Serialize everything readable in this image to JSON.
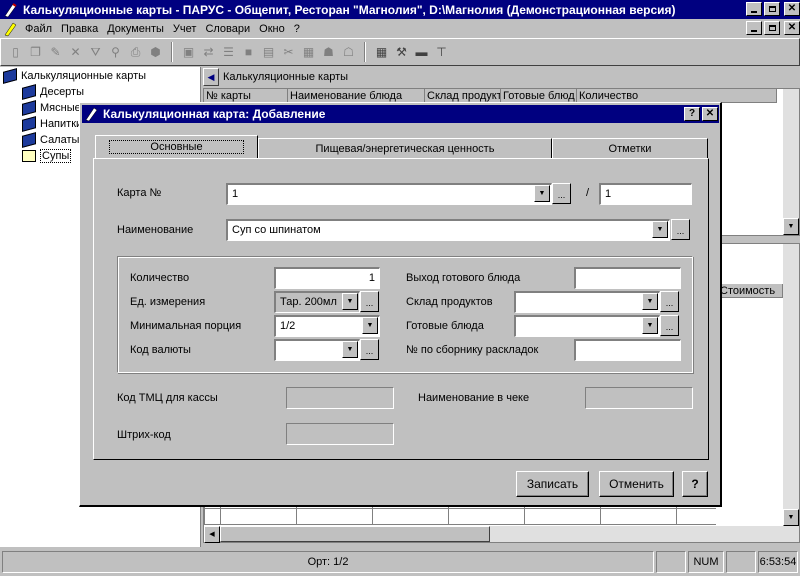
{
  "app": {
    "title": "Калькуляционные карты - ПАРУС - Общепит, Ресторан \"Магнолия\", D:\\Магнолия (Демонстрационная версия)"
  },
  "menu": {
    "items": [
      "Файл",
      "Правка",
      "Документы",
      "Учет",
      "Словари",
      "Окно",
      "?"
    ]
  },
  "tree": {
    "root": "Калькуляционные карты",
    "items": [
      "Десерты",
      "Мясные",
      "Напитки",
      "Салаты",
      "Супы"
    ]
  },
  "list_panel": {
    "title": "Калькуляционные карты",
    "columns": [
      "№ карты",
      "Наименование блюда",
      "Склад продукт",
      "Готовые блюд",
      "Количество"
    ],
    "lower_column": "Стоимость"
  },
  "dialog": {
    "title": "Калькуляционная карта: Добавление",
    "tabs": [
      "Основные",
      "Пищевая/энергетическая ценность",
      "Отметки"
    ],
    "card_label": "Карта №",
    "card_value": "1",
    "card_separator": "/",
    "card_suffix": "1",
    "name_label": "Наименование",
    "name_value": "Суп со шпинатом",
    "quantity_label": "Количество",
    "quantity_value": "1",
    "unit_label": "Ед. измерения",
    "unit_value": "Тар. 200мл",
    "min_portion_label": "Минимальная порция",
    "min_portion_value": "1/2",
    "currency_label": "Код валюты",
    "currency_value": "",
    "yield_label": "Выход готового блюда",
    "yield_value": "",
    "warehouse_label": "Склад продуктов",
    "warehouse_value": "",
    "ready_label": "Готовые блюда",
    "ready_value": "",
    "recipe_no_label": "№ по сборнику раскладок",
    "recipe_no_value": "",
    "tmc_label": "Код ТМЦ для кассы",
    "receipt_name_label": "Наименование в чеке",
    "barcode_label": "Штрих-код",
    "save_button": "Записать",
    "cancel_button": "Отменить",
    "help_button": "?",
    "dots": "..."
  },
  "status": {
    "order": "Орт: 1/2",
    "num": "NUM",
    "time": "6:53:54"
  }
}
